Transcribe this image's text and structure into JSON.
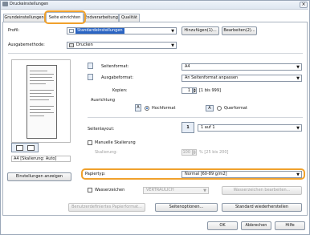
{
  "window": {
    "title": "Druckeinstellungen",
    "close": "×"
  },
  "tabs": [
    "Grundeinstellungen",
    "Seite einrichten",
    "Endverarbeitung",
    "Qualität"
  ],
  "profile": {
    "label": "Profil:",
    "value": "Standardeinstellungen",
    "add_button": "Hinzufügen(1)...",
    "edit_button": "Bearbeiten(2)..."
  },
  "output": {
    "label": "Ausgabemethode:",
    "value": "Drucken"
  },
  "page_format": {
    "label": "Seitenformat:",
    "value": "A4"
  },
  "output_format": {
    "label": "Ausgabeformat:",
    "value": "An Seitenformat anpassen"
  },
  "copies": {
    "label": "Kopien:",
    "value": "1",
    "range": "[1 bis 999]"
  },
  "orientation": {
    "label": "Ausrichtung",
    "portrait": "Hochformat",
    "landscape": "Querformat",
    "icon_letter": "A"
  },
  "page_layout": {
    "label": "Seitenlayout:",
    "value": "1 auf 1",
    "icon_number": "1"
  },
  "scaling": {
    "manual_label": "Manuelle Skalierung",
    "label": "Skalierung:",
    "value": "100",
    "unit": "% [25 bis 200]"
  },
  "preview": {
    "caption": "A4 [Skalierung: Auto]"
  },
  "settings_button": "Einstellungen anzeigen",
  "paper_type": {
    "label": "Papiertyp:",
    "value": "Normal [60-89 g/m2]"
  },
  "watermark": {
    "label": "Wasserzeichen",
    "value": "VERTRAULICH",
    "edit_button": "Wasserzeichen bearbeiten..."
  },
  "custom_format_button": "Benutzerdefiniertes Papierformat...",
  "page_options_button": "Seitenoptionen...",
  "restore_button": "Standard wiederherstellen",
  "footer": {
    "ok": "OK",
    "cancel": "Abbrechen",
    "help": "Hilfe"
  },
  "colors": {
    "highlight": "#f0a12c",
    "accent": "#1c5fb8"
  }
}
